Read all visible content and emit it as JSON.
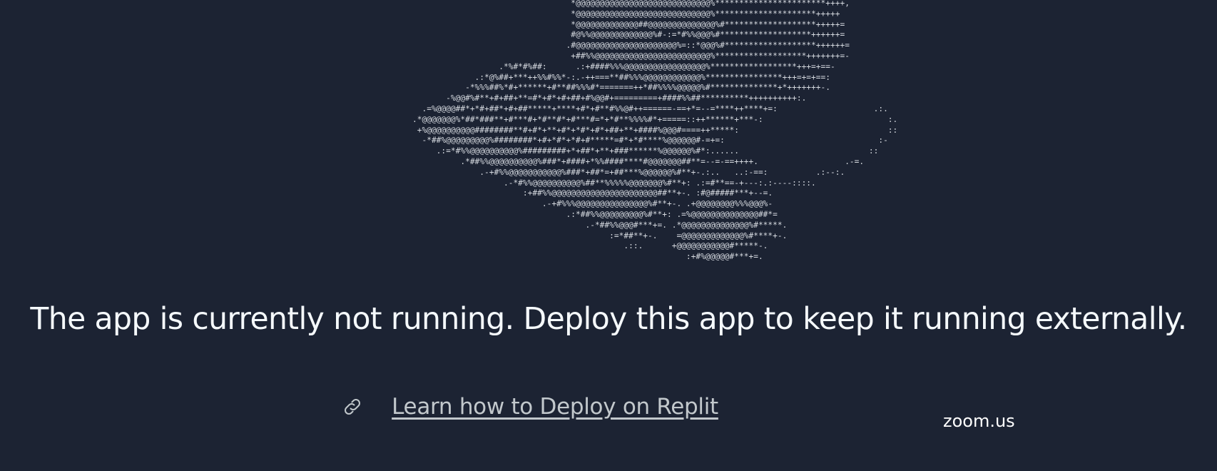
{
  "ascii_art": [
    "                                 *@@@@@@@@@@@@@@@@@@@@@@@@@@@@%***********************++++,",
    "                                 *@@@@@@@@@@@@@@@@@@@@@@@@@@@@%*********************+++++",
    "                                 *@@@@@@@@@@@@@##@@@@@@@@@@@@@@%#*******************+++++=",
    "                                 #@%%@@@@@@@@@@@@@%#-:=*#%%@@@%#*******************++++++=",
    "                                .#@@@@@@@@@@@@@@@@@@@@@%=::*@@@%#*******************++++++=",
    "                                 +##%%@@@@@@@@@@@@@@@@@@@@@@@@%*******************+++++++=-",
    "                  .*%#*#%##:      .:+####%%%@@@@@@@@@@@@@@@@@%******************+++=+==-",
    "             .:*@%##+***++%%#%%*-:.-++===**##%%%@@@@@@@@@@@@%****************+++=+=+==:",
    "           -*%%%##%*#+******+#**##%%%#*=======++*##%%%%@@@@@%#**************+*+++++++-.",
    "       -%@@#%#**+#+##+**=#*+#*+#+##+#%@@#+=========+####%%##**********++++++++++:.",
    "  .=%@@@@##*+*#+##*+#+##*****+****+#*+#**#%%@#++======-==+*=--=****++****+=:                    .:.",
    ".*@@@@@@@%*##*###**+#***#+*#**#*+#***#=*+*#**%%%%#*+=====::++******+***-:                          :.",
    " +%@@@@@@@@@@########**#+#*+**+#*+*#*+#*+##+**+####%@@@#====++*****:                               ::",
    "  -*##%@@@@@@@@@%########*+#+*#*+*#+#*****=#*+*#****%@@@@@@#-=+=:                                :-",
    "     .:=*#%%@@@@@@@@@@%#########+*+##*+**+###******%@@@@@@%#*:......                           ::",
    "          .*##%%@@@@@@@@@@%###*+####+*%%####****#@@@@@@@##**=--=-==++++.                  .-=.",
    "              .-+#%%@@@@@@@@@@@%###*+##*=+##***%@@@@@@%#**+-.:..   ..:-==:          .:--:.",
    "                   .-*#%%@@@@@@@@@@%##**%%%%%@@@@@@@%#**+: .:=#**==-+---:.:----::::.",
    "                       :+##%%@@@@@@@@@@@@@@@@@@@@@@##**+-. :#@#####***+--=.",
    "                           .-+#%%%@@@@@@@@@@@@@@@%#**+-. .+@@@@@@@@%%%@@@%-",
    "                                .:*##%%@@@@@@@@@%#**+: .=%@@@@@@@@@@@@@@##*=",
    "                                    .-*##%%@@@#***+=. .*@@@@@@@@@@@@@@%#*****.",
    "                                         :=*##**+-.    =@@@@@@@@@@@@@%#****+-.",
    "                                            .::.      +@@@@@@@@@@@#*****-.",
    "                                                         :+#%@@@@@#***+=."
  ],
  "headline": "The app is currently not running. Deploy this app to keep it running externally.",
  "link": {
    "label": "Learn how to Deploy on Replit",
    "icon": "link-icon"
  },
  "overlay_label": "zoom.us",
  "colors": {
    "background": "#1c2333",
    "text": "#f5f9fc",
    "link": "#c2c8cc"
  }
}
